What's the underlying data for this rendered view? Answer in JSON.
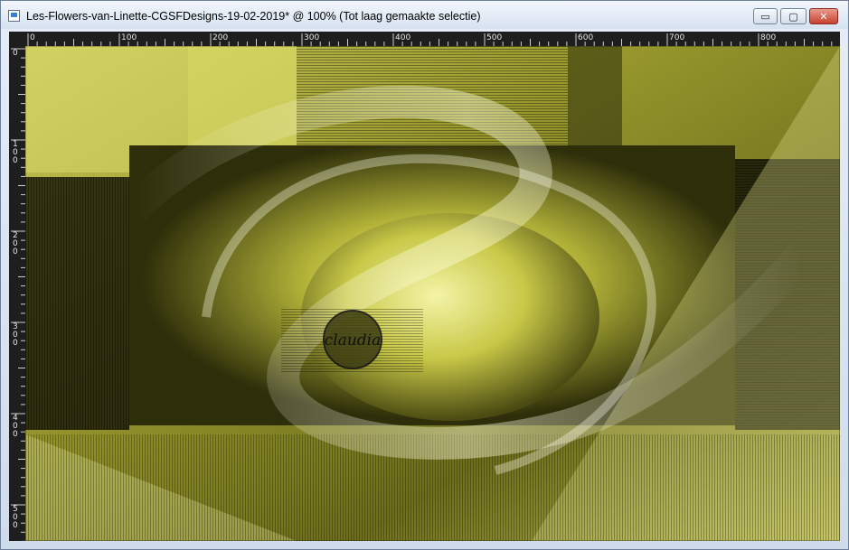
{
  "window": {
    "title": "Les-Flowers-van-Linette-CGSFDesigns-19-02-2019* @ 100% (Tot laag gemaakte selectie)",
    "buttons": {
      "minimize": "▭",
      "maximize": "▢",
      "close": "✕"
    }
  },
  "rulers": {
    "top_labels": [
      "0",
      "100",
      "200",
      "300",
      "400",
      "500",
      "600",
      "700",
      "800"
    ],
    "left_labels": [
      "0",
      "100",
      "200",
      "300",
      "400",
      "500"
    ]
  },
  "canvas": {
    "watermark": "claudia",
    "colors": {
      "yellow": "#d8d85a",
      "olive": "#6f7020",
      "dark": "#1a1a08"
    }
  }
}
